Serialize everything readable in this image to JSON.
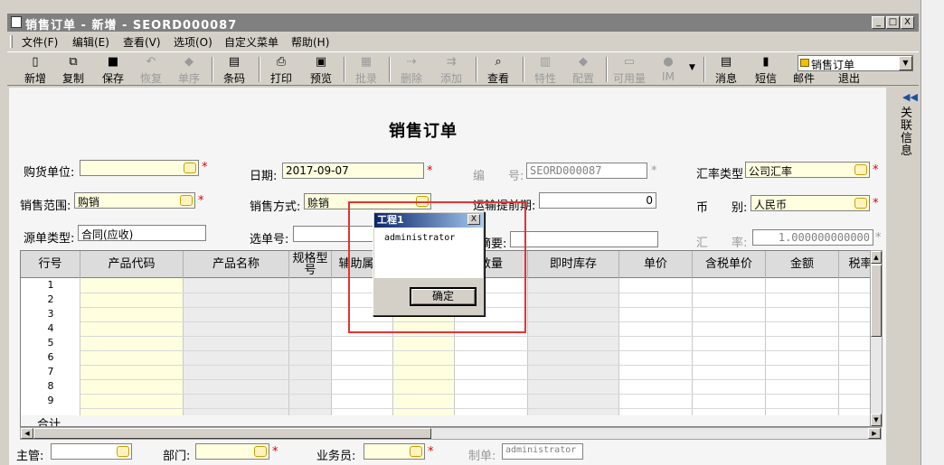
{
  "window": {
    "title": "销售订单 - 新增 - SEORD000087",
    "controls": [
      "_",
      "□",
      "X"
    ]
  },
  "menu": [
    "文件(F)",
    "编辑(E)",
    "查看(V)",
    "选项(O)",
    "自定义菜单",
    "帮助(H)"
  ],
  "toolbar": [
    {
      "label": "新增",
      "icon": "new-doc-icon",
      "enabled": true
    },
    {
      "label": "复制",
      "icon": "copy-icon",
      "enabled": true
    },
    {
      "label": "保存",
      "icon": "save-icon",
      "enabled": true
    },
    {
      "label": "恢复",
      "icon": "undo-icon",
      "enabled": false
    },
    {
      "label": "单序",
      "icon": "sequence-icon",
      "enabled": false
    },
    {
      "label": "条码",
      "icon": "barcode-icon",
      "enabled": true
    },
    {
      "label": "打印",
      "icon": "print-icon",
      "enabled": true
    },
    {
      "label": "预览",
      "icon": "preview-icon",
      "enabled": true
    },
    {
      "label": "批录",
      "icon": "batch-icon",
      "enabled": false
    },
    {
      "label": "删除",
      "icon": "delete-row-icon",
      "enabled": false
    },
    {
      "label": "添加",
      "icon": "add-row-icon",
      "enabled": false
    },
    {
      "label": "查看",
      "icon": "view-icon",
      "enabled": true
    },
    {
      "label": "特性",
      "icon": "feature-icon",
      "enabled": false
    },
    {
      "label": "配置",
      "icon": "config-icon",
      "enabled": false
    },
    {
      "label": "可用量",
      "icon": "available-icon",
      "enabled": false
    },
    {
      "label": "IM",
      "icon": "chat-icon",
      "enabled": false
    },
    {
      "label": "消息",
      "icon": "message-icon",
      "enabled": true
    },
    {
      "label": "短信",
      "icon": "sms-icon",
      "enabled": true
    },
    {
      "label": "邮件",
      "icon": "mail-icon",
      "enabled": true
    },
    {
      "label": "退出",
      "icon": "exit-icon",
      "enabled": true
    }
  ],
  "combo": {
    "value": "销售订单"
  },
  "sidepanel": {
    "label": "关联信息"
  },
  "form": {
    "title": "销售订单",
    "buyer_label": "购货单位:",
    "buyer_value": "",
    "date_label": "日期:",
    "date_value": "2017-09-07",
    "number_label": "编　　号:",
    "number_value": "SEORD000087",
    "rate_type_label": "汇率类型",
    "rate_type_value": "公司汇率",
    "scope_label": "销售范围:",
    "scope_value": "购销",
    "method_label": "销售方式:",
    "method_value": "赊销",
    "lead_label": "运输提前期:",
    "lead_value": "0",
    "currency_label": "币　　别:",
    "currency_value": "人民币",
    "source_label": "源单类型:",
    "source_value": "合同(应收)",
    "select_label": "选单号:",
    "select_value": "",
    "summary_label": "摘要:",
    "summary_value": "",
    "rate_label": "汇　　率:",
    "rate_value": "1.000000000000"
  },
  "grid": {
    "columns": [
      "行号",
      "产品代码",
      "产品名称",
      "规格型号",
      "辅助属性",
      "",
      "数量",
      "即时库存",
      "单价",
      "含税单价",
      "金额",
      "税率"
    ],
    "rows": [
      "1",
      "2",
      "3",
      "4",
      "5",
      "6",
      "7",
      "8",
      "9"
    ],
    "total_label": "合计"
  },
  "footer": {
    "manager_label": "主管:",
    "manager_value": "",
    "dept_label": "部门:",
    "dept_value": "",
    "staff_label": "业务员:",
    "staff_value": "",
    "maker_label": "制单:",
    "maker_value": "administrator"
  },
  "dialog": {
    "title": "工程1",
    "message": "administrator",
    "ok_label": "确定",
    "close": "X"
  },
  "colors": {
    "required": "#e00000",
    "highlight": "#e53333",
    "caption": "#0a246a"
  }
}
